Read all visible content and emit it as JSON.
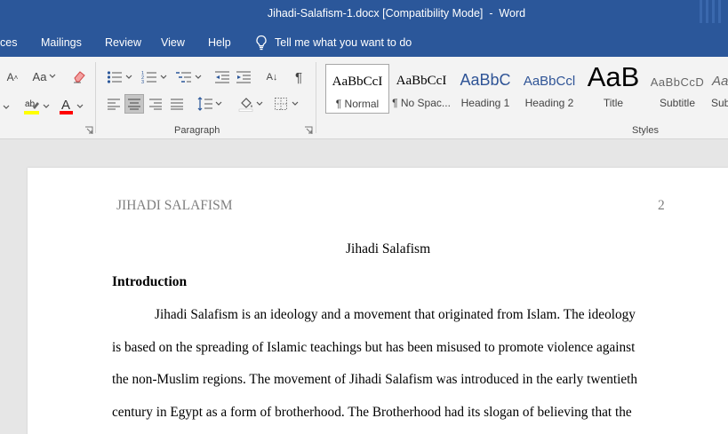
{
  "window": {
    "title": "Jihadi-Salafism-1.docx [Compatibility Mode]  -  Word"
  },
  "menu": {
    "tabs": [
      "ces",
      "Mailings",
      "Review",
      "View",
      "Help"
    ],
    "tell_me": "Tell me what you want to do"
  },
  "ribbon": {
    "paragraph_label": "Paragraph",
    "styles_label": "Styles",
    "font_case_label": "Aa",
    "grow_font_label": "A",
    "sort_label": "A↓",
    "pilcrow": "¶",
    "styles": [
      {
        "preview": "AaBbCcI",
        "name": "¶ Normal"
      },
      {
        "preview": "AaBbCcI",
        "name": "¶ No Spac..."
      },
      {
        "preview": "AaBbC",
        "name": "Heading 1"
      },
      {
        "preview": "AaBbCcl",
        "name": "Heading 2"
      },
      {
        "preview": "AaB",
        "name": "Title"
      },
      {
        "preview": "AaBbCcD",
        "name": "Subtitle"
      },
      {
        "preview": "Aa",
        "name": "Sub"
      }
    ],
    "colors": {
      "highlight": "#ffff00",
      "font_color": "#ff0000",
      "heading": "#2f5496"
    }
  },
  "document": {
    "header_left": "JIHADI SALAFISM",
    "page_number": "2",
    "title": "Jihadi Salafism",
    "section_heading": "Introduction",
    "paragraph_lines": [
      "Jihadi Salafism is an ideology and a movement that originated from Islam. The ideology",
      "is based on the spreading of Islamic teachings but has been misused to promote violence against",
      "the non-Muslim regions. The movement of Jihadi Salafism was introduced in the early twentieth",
      "century in Egypt as a form of brotherhood. The Brotherhood had its slogan of believing that the"
    ]
  }
}
